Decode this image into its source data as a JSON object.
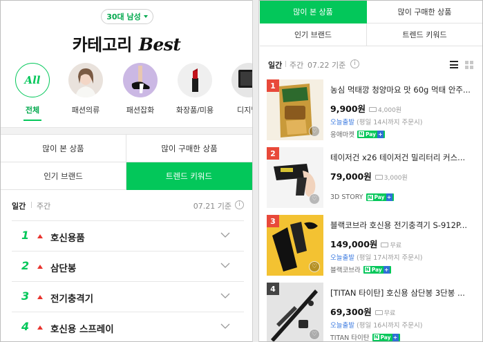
{
  "left": {
    "age_filter": "30대 남성",
    "title_ko": "카테고리",
    "title_en": "Best",
    "categories": [
      {
        "label": "전체",
        "icon_text": "All"
      },
      {
        "label": "패션의류"
      },
      {
        "label": "패션잡화"
      },
      {
        "label": "화장품/미용"
      },
      {
        "label": "디지털/"
      }
    ],
    "tabs": [
      "많이 본 상품",
      "많이 구매한 상품",
      "인기 브랜드",
      "트렌드 키워드"
    ],
    "active_tab": 3,
    "period": {
      "daily": "일간",
      "weekly": "주간",
      "date": "07.21 기준"
    },
    "keywords": [
      {
        "rank": "1",
        "keyword": "호신용품"
      },
      {
        "rank": "2",
        "keyword": "삼단봉"
      },
      {
        "rank": "3",
        "keyword": "전기충격기"
      },
      {
        "rank": "4",
        "keyword": "호신용 스프레이"
      }
    ]
  },
  "right": {
    "tabs": [
      "많이 본 상품",
      "많이 구매한 상품",
      "인기 브랜드",
      "트렌드 키워드"
    ],
    "active_tab": 0,
    "period": {
      "daily": "일간",
      "weekly": "주간",
      "date": "07.22 기준"
    },
    "products": [
      {
        "rank": "1",
        "name": "농심 먹태깡 청양마요 맛 60g 먹태 안주...",
        "price": "9,900원",
        "shipping": "4,000원",
        "delivery": "오늘출발",
        "delivery_note": "(평일 14시까지 주문시)",
        "seller": "응애마켓",
        "badge_color": "#e8493a"
      },
      {
        "rank": "2",
        "name": "테이저건 x26 테이저건 밀리터리 커스...",
        "price": "79,000원",
        "shipping": "3,000원",
        "delivery": "",
        "delivery_note": "",
        "seller": "3D STORY",
        "badge_color": "#e8493a"
      },
      {
        "rank": "3",
        "name": "블랙코브라 호신용 전기충격기 S-912P...",
        "price": "149,000원",
        "shipping": "무료",
        "delivery": "오늘출발",
        "delivery_note": "(평일 17시까지 주문시)",
        "seller": "블랙코브라",
        "badge_color": "#e8493a"
      },
      {
        "rank": "4",
        "name": "[TITAN 타이탄] 호신용 삼단봉 3단봉 ...",
        "price": "69,300원",
        "shipping": "무료",
        "delivery": "오늘출발",
        "delivery_note": "(평일 16시까지 주문시)",
        "seller": "TITAN 타이탄",
        "badge_color": "#444444"
      }
    ]
  },
  "colors": {
    "accent": "#03c75a",
    "rank_up": "#e8332d",
    "delivery": "#3d7be0"
  },
  "npay_label": "Pay"
}
